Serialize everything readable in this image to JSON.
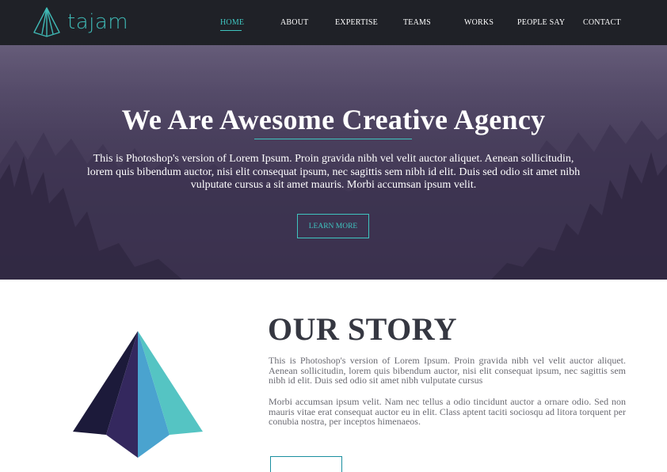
{
  "brand": {
    "name": "tajam",
    "logo_icon": "pyramid-logo-icon",
    "accent_color": "#3fc5c0"
  },
  "nav": {
    "items": [
      {
        "label": "HOME",
        "active": true
      },
      {
        "label": "ABOUT",
        "active": false
      },
      {
        "label": "EXPERTISE",
        "active": false
      },
      {
        "label": "TEAMS",
        "active": false
      },
      {
        "label": "WORKS",
        "active": false
      },
      {
        "label": "PEOPLE SAY",
        "active": false
      },
      {
        "label": "CONTACT",
        "active": false
      }
    ]
  },
  "hero": {
    "title": "We Are Awesome Creative Agency",
    "text": "This is Photoshop's version of Lorem Ipsum. Proin gravida nibh vel velit auctor aliquet. Aenean sollicitudin, lorem quis bibendum auctor, nisi elit consequat ipsum, nec sagittis sem nibh id elit. Duis sed odio sit amet nibh vulputate cursus a sit amet mauris. Morbi accumsan ipsum velit.",
    "button_label": "LEARN MORE"
  },
  "story": {
    "title": "OUR STORY",
    "paragraph1": "This is Photoshop's version of Lorem Ipsum. Proin gravida nibh vel velit auctor aliquet. Aenean sollicitudin, lorem quis bibendum auctor, nisi elit consequat ipsum, nec sagittis sem nibh id elit. Duis sed odio sit amet nibh vulputate cursus",
    "paragraph2": "Morbi accumsan ipsum velit. Nam nec tellus a odio tincidunt auctor a ornare odio. Sed non mauris vitae erat consequat auctor eu in elit. Class aptent taciti sociosqu ad litora torquent per conubia nostra, per inceptos himenaeos.",
    "graphic_icon": "pyramid-graphic-icon"
  }
}
